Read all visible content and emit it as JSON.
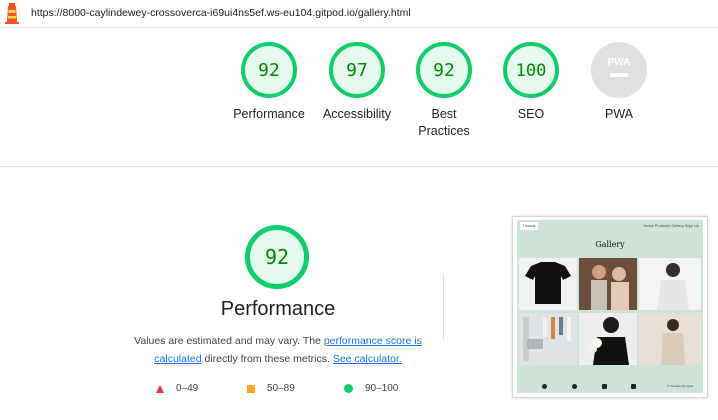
{
  "header": {
    "url": "https://8000-caylindewey-crossoverca-i69ui4ns5ef.ws-eu104.gitpod.io/gallery.html"
  },
  "colors": {
    "pass": "#0cce6b",
    "pass_text": "#008800",
    "pass_bg": "#e5f9ee",
    "pwa_bg": "#e0e0e0",
    "fail": "#e53935",
    "average": "#f6a623",
    "link": "#1a73e8"
  },
  "gauges": [
    {
      "score": 92,
      "label": "Performance"
    },
    {
      "score": 97,
      "label": "Accessibility"
    },
    {
      "score": 92,
      "label": "Best Practices"
    },
    {
      "score": 100,
      "label": "SEO"
    },
    {
      "score": null,
      "label": "PWA",
      "badge": "PWA"
    }
  ],
  "detail": {
    "score": 92,
    "title": "Performance",
    "desc_1": "Values are estimated and may vary. The ",
    "link_score": "performance score is calculated",
    "desc_2": " directly from these metrics. ",
    "link_calc": "See calculator."
  },
  "legend": [
    {
      "range": "0–49",
      "shape": "triangle"
    },
    {
      "range": "50–89",
      "shape": "square"
    },
    {
      "range": "90–100",
      "shape": "circle"
    }
  ],
  "screenshot": {
    "logo": "Threads",
    "nav_links": "Home   Products   Gallery   Sign Up",
    "title": "Gallery",
    "copyright": "© Threads All rights",
    "footer_icons": [
      "facebook-icon",
      "instagram-icon",
      "twitter-icon",
      "youtube-icon"
    ]
  }
}
